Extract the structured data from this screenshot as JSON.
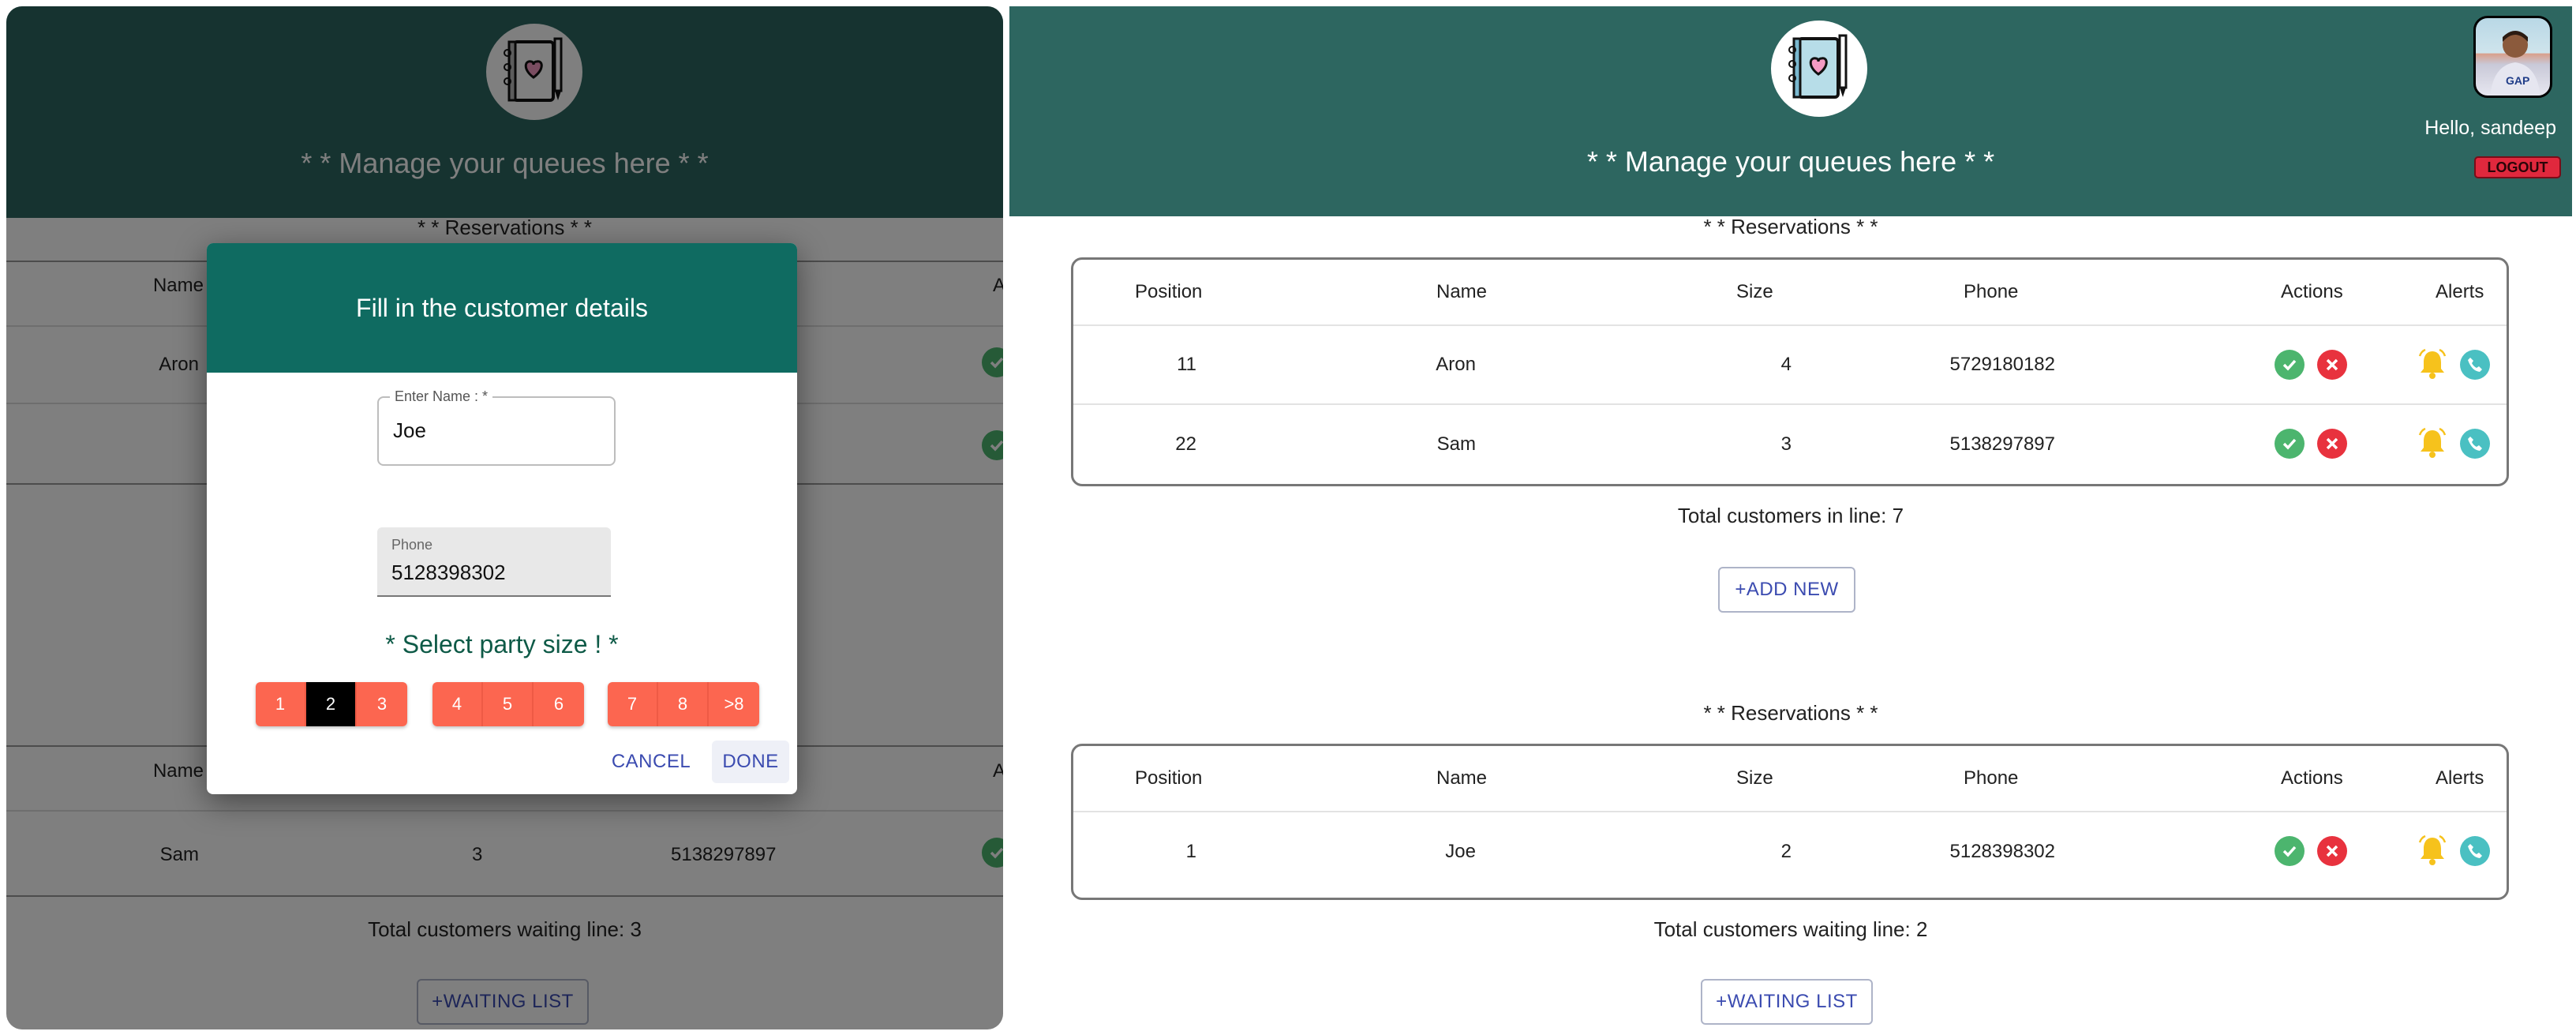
{
  "left_panel": {
    "header_title": "* * Manage your queues here * *",
    "section_title": "* * Reservations * *",
    "table_top": {
      "col_name": "Name",
      "col_actions_partial": "A",
      "row_name": "Aron"
    },
    "table_bottom": {
      "col_name": "Name",
      "col_actions_partial": "A",
      "row": {
        "name": "Sam",
        "size": "3",
        "phone": "5138297897"
      }
    },
    "total_waiting": "Total customers waiting line: 3",
    "waiting_button": "+WAITING LIST"
  },
  "dialog": {
    "title": "Fill in the customer details",
    "name_label": "Enter Name : *",
    "name_value": "Joe",
    "phone_label": "Phone",
    "phone_value": "5128398302",
    "party_label": "* Select party size ! *",
    "sizes_group1": [
      "1",
      "2",
      "3"
    ],
    "sizes_group2": [
      "4",
      "5",
      "6"
    ],
    "sizes_group3": [
      "7",
      "8",
      ">8"
    ],
    "selected_size": "2",
    "cancel": "CANCEL",
    "done": "DONE"
  },
  "right_panel": {
    "header_title": "* * Manage your queues here * *",
    "greeting": "Hello, sandeep",
    "logout": "LOGOUT",
    "columns": {
      "position": "Position",
      "name": "Name",
      "size": "Size",
      "phone": "Phone",
      "actions": "Actions",
      "alerts": "Alerts"
    },
    "reservations": {
      "title": "* * Reservations * *",
      "rows": [
        {
          "position": "11",
          "name": "Aron",
          "size": "4",
          "phone": "5729180182"
        },
        {
          "position": "22",
          "name": "Sam",
          "size": "3",
          "phone": "5138297897"
        }
      ],
      "total": "Total customers in line: 7",
      "button": "+ADD NEW"
    },
    "waiting": {
      "title": "* * Reservations * *",
      "rows": [
        {
          "position": "1",
          "name": "Joe",
          "size": "2",
          "phone": "5128398302"
        }
      ],
      "total": "Total customers waiting line: 2",
      "button": "+WAITING LIST"
    }
  },
  "colors": {
    "header": "#2d6660",
    "dialog_header": "#0f6b61",
    "size_button": "#fc6650",
    "selected_size": "#000000",
    "accept": "#4cb56e",
    "reject": "#e8323e",
    "bell": "#f6c21c",
    "call": "#4ac0c2",
    "logout": "#e0283d"
  },
  "icons": [
    "notebook-heart-logo",
    "check-circle-icon",
    "cancel-circle-icon",
    "bell-icon",
    "phone-call-icon",
    "avatar"
  ]
}
